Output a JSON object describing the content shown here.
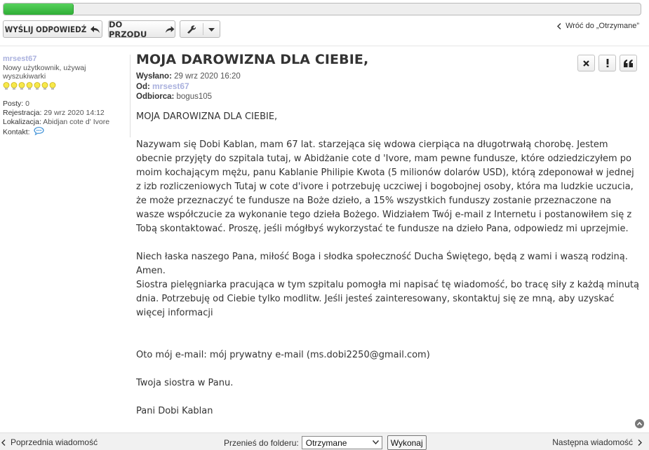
{
  "progress": {
    "fraction": 0.11,
    "color": "#3cbf42"
  },
  "toolbar": {
    "reply_label": "Wyślij odpowiedź",
    "forward_label": "Do przodu",
    "return_label": "Wróć do „Otrzymane”",
    "icons": {
      "reply": "reply-arrow-icon",
      "forward": "forward-arrow-icon",
      "tools": "wrench-icon"
    }
  },
  "author": {
    "name": "mrsest67",
    "rank": "Nowy użytkownik, używaj wyszukiwarki",
    "rank_stars": 7,
    "profile": [
      {
        "label": "Posty:",
        "value": "0"
      },
      {
        "label": "Rejestracja:",
        "value": "29 wrz 2020 14:12"
      },
      {
        "label": "Lokalizacja:",
        "value": "Abidjan cote d' Ivore"
      }
    ],
    "contact_label": "Kontakt:"
  },
  "message": {
    "title": "MOJA DAROWIZNA DLA CIEBIE,",
    "sent_label": "Wysłano:",
    "sent_value": "29 wrz 2020 16:20",
    "from_label": "Od:",
    "from_value": "mrsest67",
    "to_label": "Odbiorca:",
    "to_value": "bogus105",
    "paragraphs": [
      "MOJA DAROWIZNA DLA CIEBIE,",
      "Nazywam się Dobi Kablan, mam 67 lat. starzejąca się wdowa cierpiąca na długotrwałą chorobę. Jestem obecnie przyjęty do szpitala tutaj, w Abidżanie cote d 'Ivore, mam pewne fundusze, które odziedziczyłem po moim kochającym mężu, panu Kablanie Philipie Kwota (5 milionów dolarów USD), którą zdeponował w jednej z izb rozliczeniowych Tutaj w cote d'ivore i potrzebuję uczciwej i bogobojnej osoby, która ma ludzkie uczucia, że może przeznaczyć te fundusze na Boże dzieło, a 15% wszystkich funduszy zostanie przeznaczone na wasze współczucie za wykonanie tego dzieła Bożego. Widziałem Twój e-mail z Internetu i postanowiłem się z Tobą skontaktować. Proszę, jeśli mógłbyś wykorzystać te fundusze na dzieło Pana, odpowiedz mi uprzejmie.",
      "Niech łaska naszego Pana, miłość Boga i słodka społeczność Ducha Świętego, będą z wami i waszą rodziną. Amen.\nSiostra pielęgniarka pracująca w tym szpitalu pomogła mi napisać tę wiadomość, bo tracę siły z każdą minutą dnia. Potrzebuję od Ciebie tylko modlitw. Jeśli jesteś zainteresowany, skontaktuj się ze mną, aby uzyskać więcej informacji",
      "",
      "Oto mój e-mail: mój prywatny e-mail (ms.dobi2250@gmail.com)",
      "Twoja siostra w Panu.",
      "Pani Dobi Kablan"
    ],
    "actions": [
      "delete-icon",
      "report-icon",
      "quote-icon"
    ]
  },
  "footer": {
    "prev_label": "Poprzednia wiadomość",
    "move_label": "Przenieś do folderu:",
    "folder_selected": "Otrzymane",
    "go_label": "Wykonaj",
    "next_label": "Następna wiadomość"
  },
  "colors": {
    "link": "#aab1de",
    "accent_green": "#3cbf42",
    "footer_bg": "#f1f1f1"
  }
}
